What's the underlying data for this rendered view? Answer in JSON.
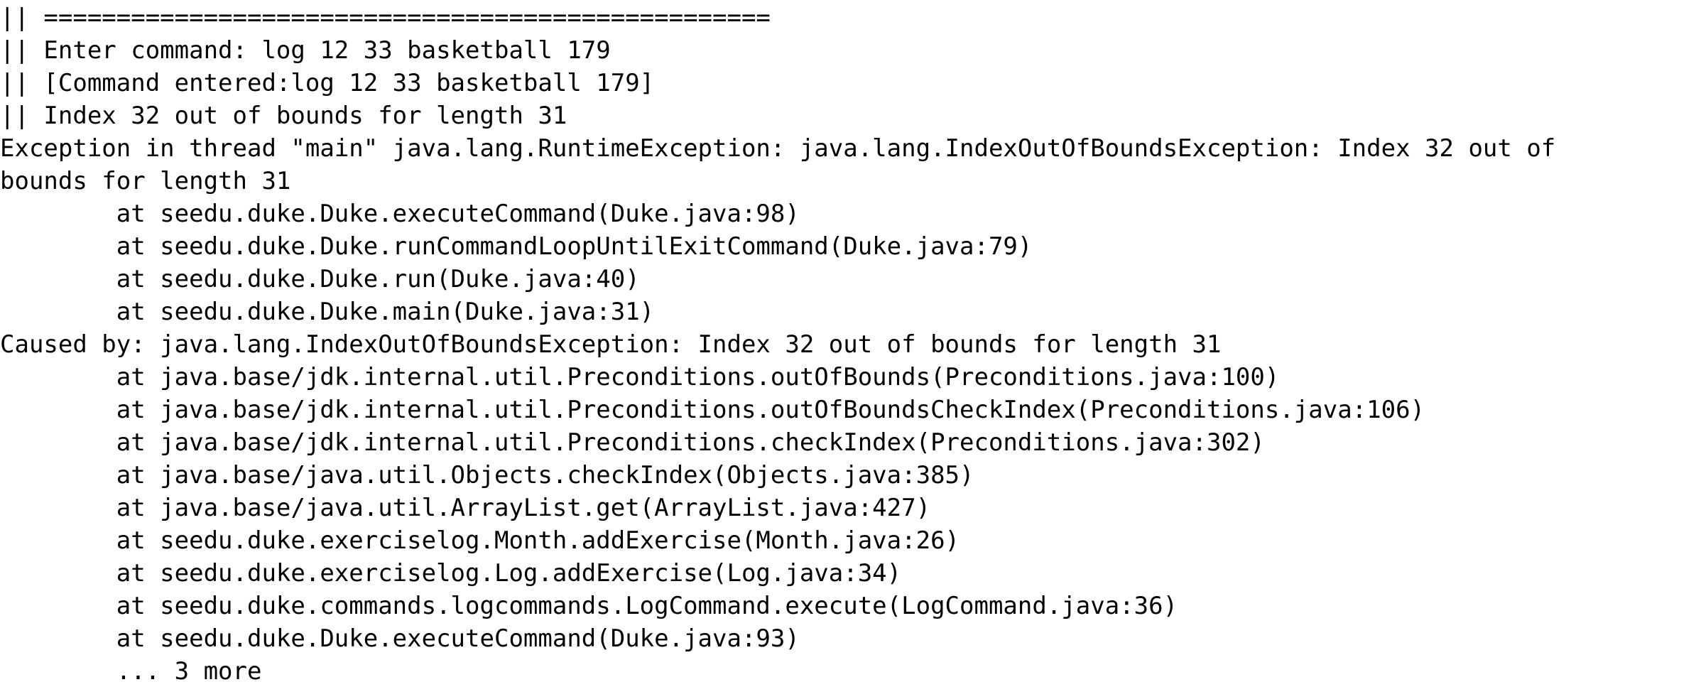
{
  "terminal": {
    "lines": [
      "|| ==================================================",
      "|| Enter command: log 12 33 basketball 179",
      "|| [Command entered:log 12 33 basketball 179]",
      "|| Index 32 out of bounds for length 31",
      "Exception in thread \"main\" java.lang.RuntimeException: java.lang.IndexOutOfBoundsException: Index 32 out of",
      "bounds for length 31",
      "        at seedu.duke.Duke.executeCommand(Duke.java:98)",
      "        at seedu.duke.Duke.runCommandLoopUntilExitCommand(Duke.java:79)",
      "        at seedu.duke.Duke.run(Duke.java:40)",
      "        at seedu.duke.Duke.main(Duke.java:31)",
      "Caused by: java.lang.IndexOutOfBoundsException: Index 32 out of bounds for length 31",
      "        at java.base/jdk.internal.util.Preconditions.outOfBounds(Preconditions.java:100)",
      "        at java.base/jdk.internal.util.Preconditions.outOfBoundsCheckIndex(Preconditions.java:106)",
      "        at java.base/jdk.internal.util.Preconditions.checkIndex(Preconditions.java:302)",
      "        at java.base/java.util.Objects.checkIndex(Objects.java:385)",
      "        at java.base/java.util.ArrayList.get(ArrayList.java:427)",
      "        at seedu.duke.exerciselog.Month.addExercise(Month.java:26)",
      "        at seedu.duke.exerciselog.Log.addExercise(Log.java:34)",
      "        at seedu.duke.commands.logcommands.LogCommand.execute(LogCommand.java:36)",
      "        at seedu.duke.Duke.executeCommand(Duke.java:93)",
      "        ... 3 more"
    ]
  }
}
